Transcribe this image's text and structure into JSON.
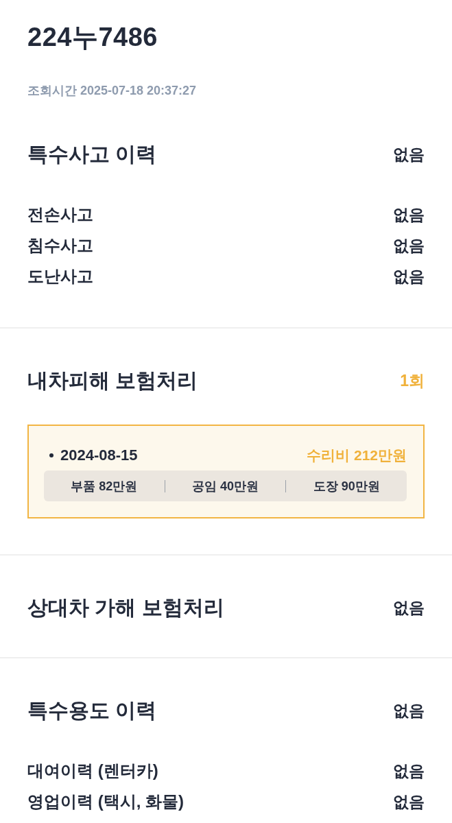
{
  "vehicle": {
    "plate": "224누7486",
    "lookup_time": "조회시간 2025-07-18 20:37:27"
  },
  "sections": [
    {
      "title": "특수사고 이력",
      "status": "없음",
      "highlight": false,
      "items": [
        {
          "label": "전손사고",
          "value": "없음"
        },
        {
          "label": "침수사고",
          "value": "없음"
        },
        {
          "label": "도난사고",
          "value": "없음"
        }
      ]
    },
    {
      "title": "내차피해 보험처리",
      "status": "1회",
      "highlight": true,
      "claims": [
        {
          "date": "2024-08-15",
          "total": "수리비 212만원",
          "breakdown": [
            "부품 82만원",
            "공임 40만원",
            "도장 90만원"
          ]
        }
      ]
    },
    {
      "title": "상대차 가해 보험처리",
      "status": "없음",
      "highlight": false
    },
    {
      "title": "특수용도 이력",
      "status": "없음",
      "highlight": false,
      "items": [
        {
          "label": "대여이력 (렌터카)",
          "value": "없음"
        },
        {
          "label": "영업이력 (택시, 화물)",
          "value": "없음"
        }
      ]
    }
  ]
}
